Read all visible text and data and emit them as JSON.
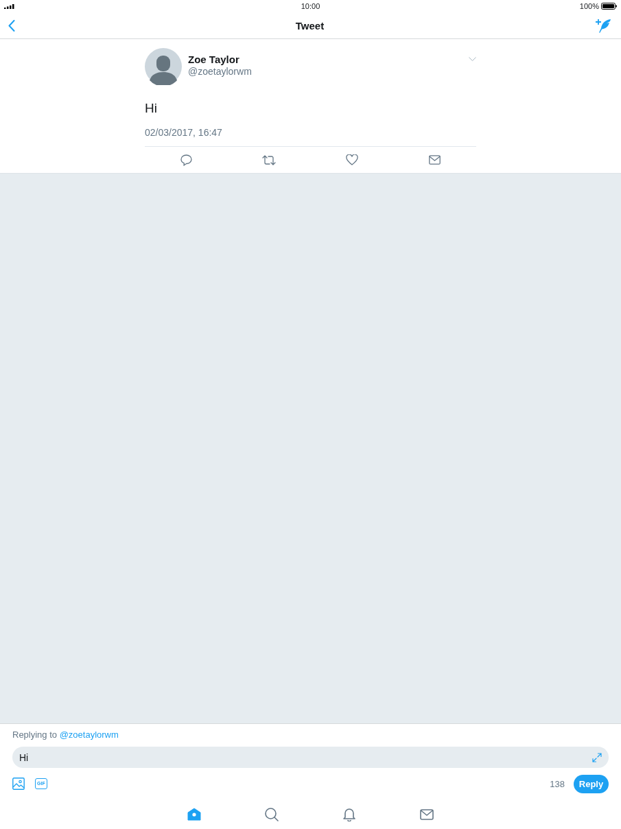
{
  "status_bar": {
    "time": "10:00",
    "battery": "100%"
  },
  "nav_bar": {
    "title": "Tweet"
  },
  "tweet": {
    "author": {
      "name": "Zoe Taylor",
      "handle": "@zoetaylorwm"
    },
    "text": "Hi",
    "timestamp": "02/03/2017, 16:47"
  },
  "composer": {
    "replying_label": "Replying to",
    "replying_handle": "@zoetaylorwm",
    "value": "Hi",
    "gif_label": "GIF",
    "counter": "138",
    "reply_button": "Reply"
  },
  "tab_bar": [
    {
      "kind": "home",
      "selected": true
    },
    {
      "kind": "search",
      "selected": false
    },
    {
      "kind": "bell",
      "selected": false
    },
    {
      "kind": "mail",
      "selected": false
    }
  ]
}
